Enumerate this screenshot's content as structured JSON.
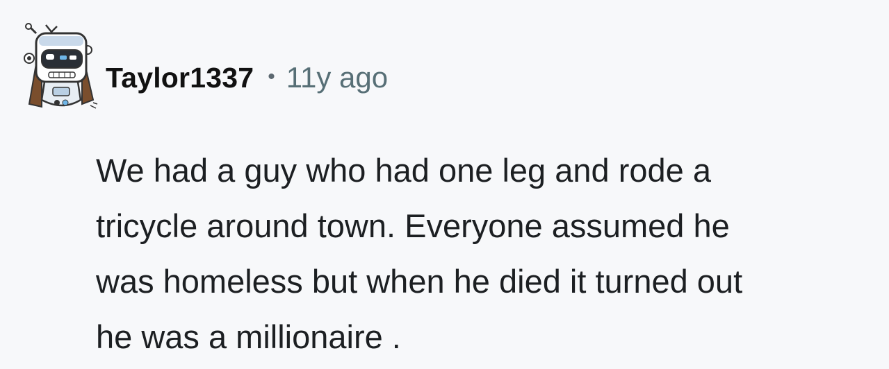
{
  "comment": {
    "author": {
      "username": "Taylor1337",
      "avatar_icon": "robot-avatar-icon"
    },
    "separator": "•",
    "age": "11y ago",
    "lines": [
      "We had a guy who had one leg and rode a",
      "tricycle around town. Everyone assumed he",
      "was homeless but when he died it turned out",
      "he was a millionaire ."
    ]
  },
  "colors": {
    "background": "#f7f8fa",
    "username": "#111111",
    "meta_text": "#576f76",
    "body_text": "#1c1f22"
  }
}
